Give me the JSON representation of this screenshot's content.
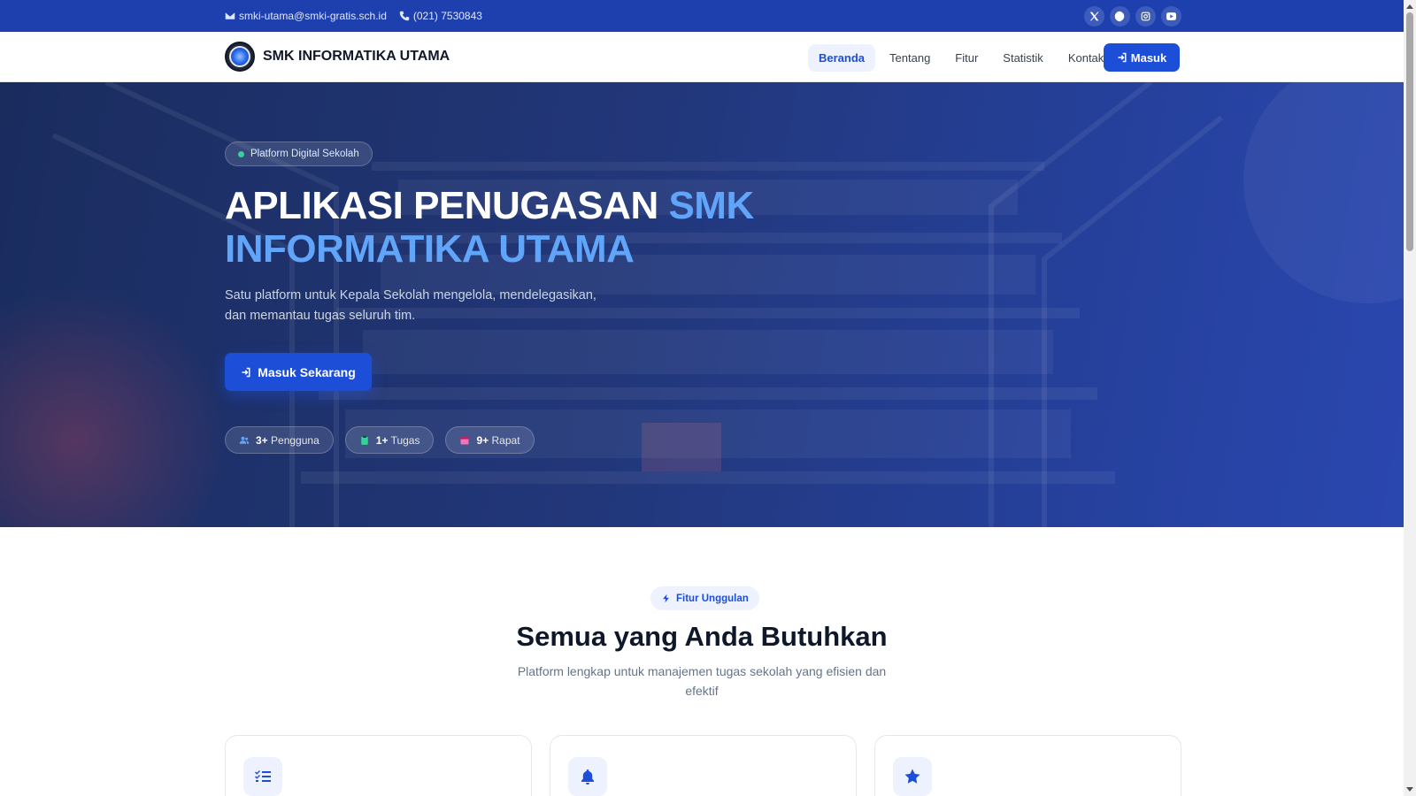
{
  "topbar": {
    "email": "smki-utama@smki-gratis.sch.id",
    "phone": "(021) 7530843",
    "socials": [
      "x-icon",
      "facebook-icon",
      "instagram-icon",
      "youtube-icon"
    ]
  },
  "nav": {
    "brand": "SMK INFORMATIKA UTAMA",
    "links": [
      "Beranda",
      "Tentang",
      "Fitur",
      "Statistik",
      "Kontak"
    ],
    "active": "Beranda",
    "login_label": "Masuk"
  },
  "hero": {
    "badge": "Platform Digital Sekolah",
    "title_plain": "APLIKASI PENUGASAN",
    "title_highlight": "SMK INFORMATIKA UTAMA",
    "subtitle": "Satu platform untuk Kepala Sekolah mengelola, mendelegasikan, dan memantau tugas seluruh tim.",
    "cta_label": "Masuk Sekarang",
    "stats": [
      {
        "value": "3+",
        "label": "Pengguna",
        "icon": "users-icon",
        "color": "#3b82f6"
      },
      {
        "value": "1+",
        "label": "Tugas",
        "icon": "clipboard-icon",
        "color": "#34d399"
      },
      {
        "value": "9+",
        "label": "Rapat",
        "icon": "calendar-icon",
        "color": "#f472b6"
      }
    ]
  },
  "features": {
    "tag": "Fitur Unggulan",
    "title": "Semua yang Anda Butuhkan",
    "subtitle": "Platform lengkap untuk manajemen tugas sekolah yang efisien dan efektif",
    "cards": [
      {
        "icon": "checklist-icon"
      },
      {
        "icon": "bell-icon"
      },
      {
        "icon": "star-icon"
      }
    ]
  },
  "colors": {
    "primary": "#1d4ed8",
    "topbar": "#1e40af",
    "highlight": "#60a5fa"
  }
}
